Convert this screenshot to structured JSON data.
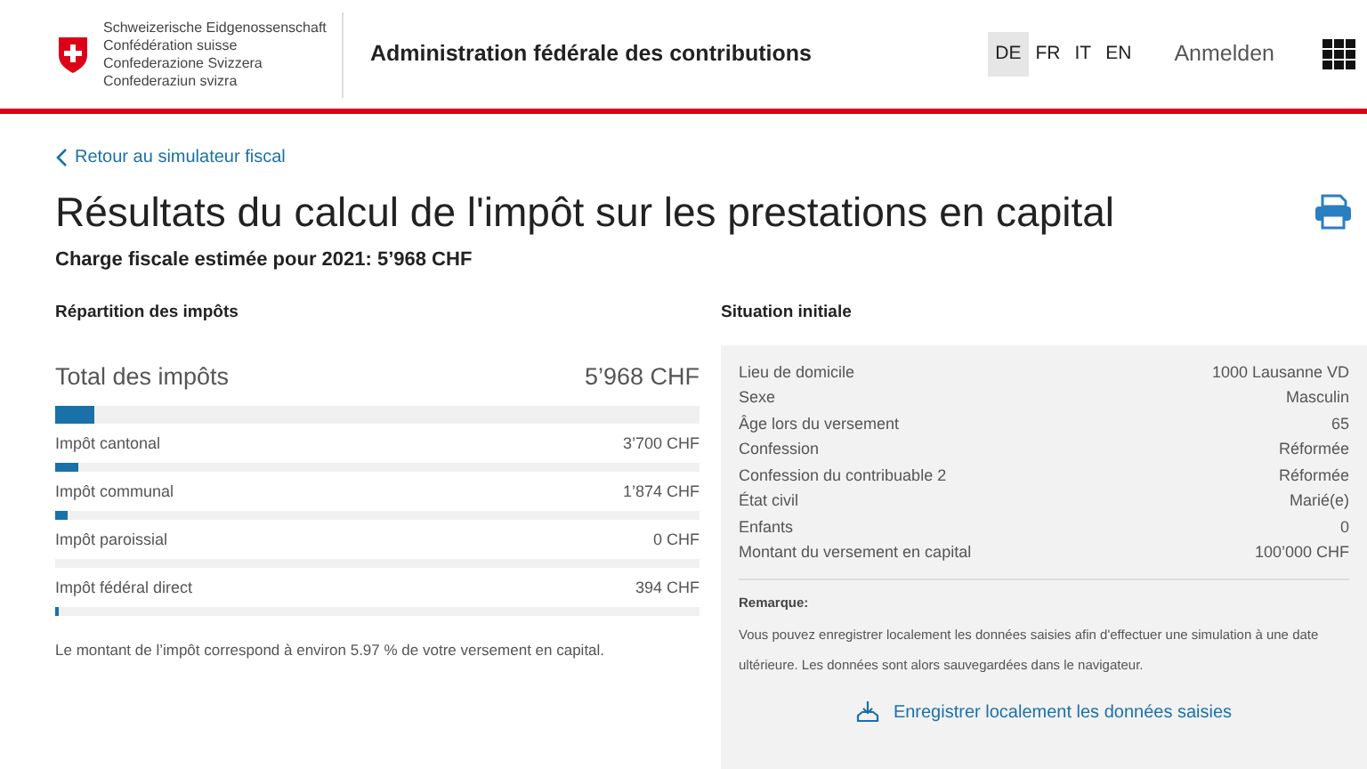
{
  "header": {
    "org_lines": [
      "Schweizerische Eidgenossenschaft",
      "Confédération suisse",
      "Confederazione Svizzera",
      "Confederaziun svizra"
    ],
    "title": "Administration fédérale des contributions",
    "languages": [
      {
        "label": "DE",
        "selected": true
      },
      {
        "label": "FR",
        "selected": false
      },
      {
        "label": "IT",
        "selected": false
      },
      {
        "label": "EN",
        "selected": false
      }
    ],
    "login": "Anmelden"
  },
  "back_link": "Retour au simulateur fiscal",
  "page_title": "Résultats du calcul de l'impôt sur les prestations en capital",
  "subtitle": "Charge fiscale estimée pour 2021: 5’968 CHF",
  "breakdown": {
    "heading": "Répartition des impôts",
    "total": {
      "label": "Total des impôts",
      "amount": "5’968 CHF",
      "level": 0.06
    },
    "items": [
      {
        "label": "Impôt cantonal",
        "amount": "3’700 CHF",
        "level": 0.036
      },
      {
        "label": "Impôt communal",
        "amount": "1’874 CHF",
        "level": 0.019
      },
      {
        "label": "Impôt paroissial",
        "amount": "0 CHF"
      },
      {
        "label": "Impôt fédéral direct",
        "amount": "394 CHF",
        "level": 0.005
      }
    ],
    "note": "Le montant de l’impôt correspond à environ 5.97 % de votre versement en capital."
  },
  "situation": {
    "heading": "Situation initiale",
    "rows": [
      {
        "label": "Lieu de domicile",
        "value": "1000 Lausanne VD"
      },
      {
        "label": "Sexe",
        "value": "Masculin"
      },
      {
        "label": "Âge lors du versement",
        "value": "65"
      },
      {
        "label": "Confession",
        "value": "Réformée"
      },
      {
        "label": "Confession du contribuable 2",
        "value": "Réformée"
      },
      {
        "label": "État civil",
        "value": "Marié(e)"
      },
      {
        "label": "Enfants",
        "value": "0"
      },
      {
        "label": "Montant du versement en capital",
        "value": "100’000 CHF"
      }
    ],
    "remark_title": "Remarque:",
    "remark": "Vous pouvez enregistrer localement les données saisies afin d'effectuer une simulation à une date ultérieure. Les données sont alors sauvegardées dans le navigateur.",
    "save_link": "Enregistrer localement les données saisies"
  }
}
